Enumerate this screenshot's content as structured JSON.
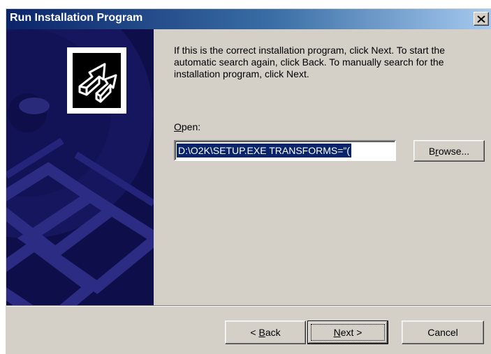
{
  "window": {
    "title": "Run Installation Program"
  },
  "content": {
    "message": "If this is the correct installation program, click Next. To start the automatic search again, click Back. To manually search for the installation program, click Next.",
    "open_label_prefix": "O",
    "open_label_rest": "pen:",
    "open_value": "D:\\O2K\\SETUP.EXE TRANSFORMS=\"("
  },
  "buttons": {
    "browse_u": "r",
    "browse_pre": "B",
    "browse_post": "owse...",
    "back_pre": "< ",
    "back_u": "B",
    "back_post": "ack",
    "next_u": "N",
    "next_post": "ext >",
    "cancel": "Cancel"
  },
  "icons": {
    "close": "close-icon",
    "logo": "setup-arrow-icon"
  },
  "colors": {
    "title_start": "#0a246a",
    "title_end": "#a6caf0",
    "panel": "#0e0e4a",
    "face": "#d4d0c8",
    "selection": "#0a246a"
  }
}
